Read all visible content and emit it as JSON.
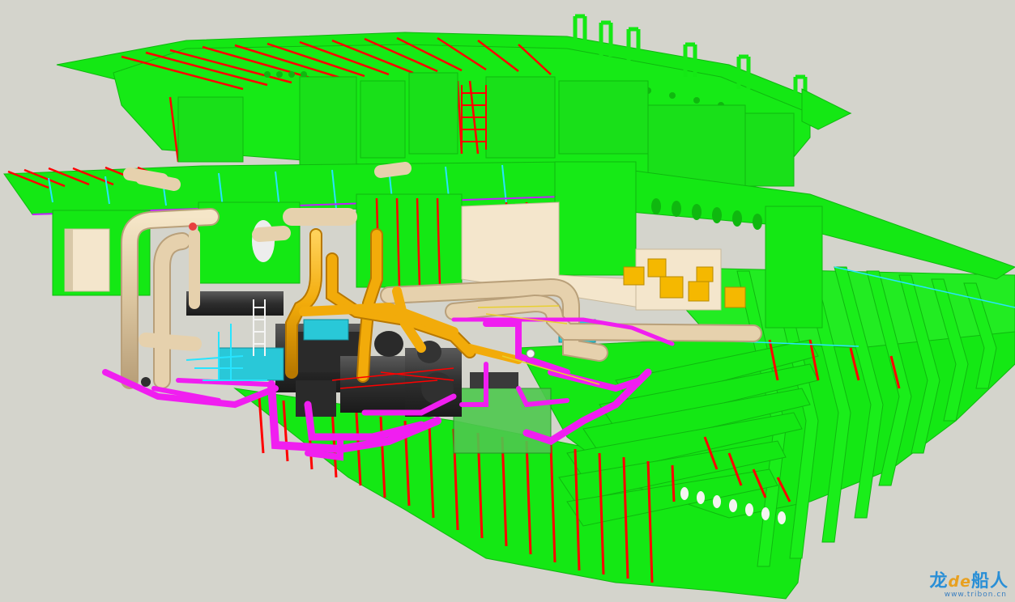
{
  "viewer": {
    "background": "#d4d4cc",
    "colors": {
      "structure": "#14e814",
      "structure_dark": "#0fb80f",
      "profiles": "#ff0000",
      "edges_cyan": "#27e4ff",
      "pipe_beige": "#e6d1ad",
      "pipe_orange": "#f2ab0a",
      "pipe_magenta": "#f01ef0",
      "machinery_dark": "#3a3a3a",
      "machinery_cyan": "#29c8d8",
      "cream_block": "#f4e6cc",
      "blue_part": "#1f2fd8"
    }
  },
  "watermark": {
    "brand_left": "龙",
    "brand_mid": "de",
    "brand_right": "船人",
    "url": "www.tribon.cn"
  }
}
